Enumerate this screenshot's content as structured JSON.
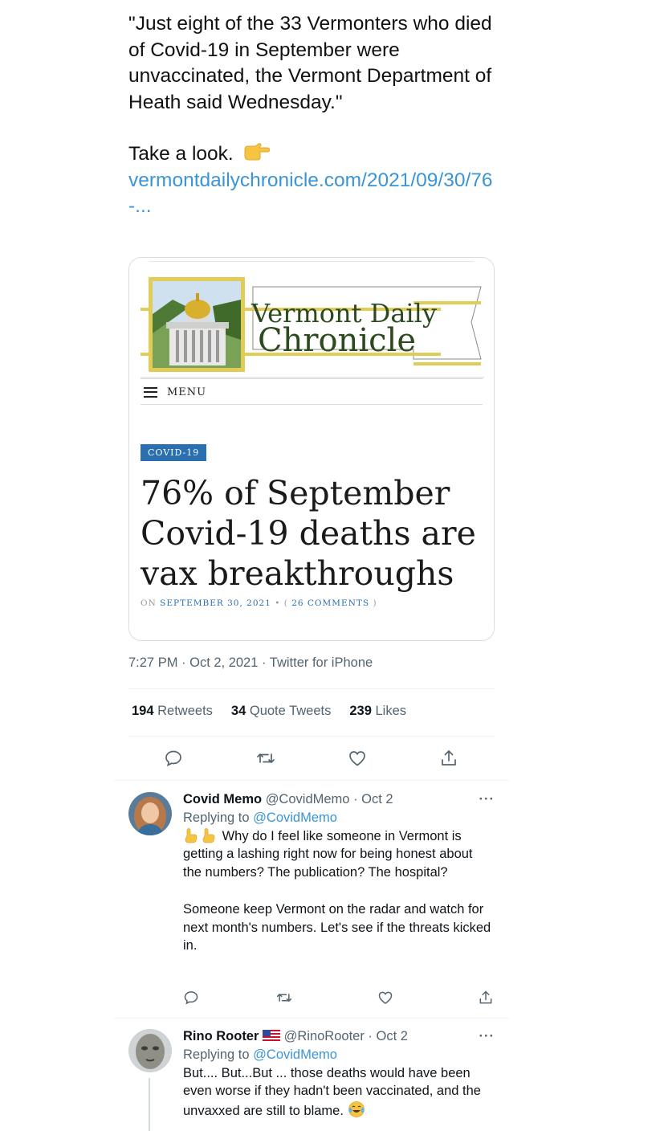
{
  "tweet": {
    "quote": "\"Just eight of the 33 Vermonters who died of  Covid-19 in September were unvaccinated, the Vermont Department of Heath said Wednesday.\"",
    "take_a_look": "Take a look.",
    "link": "vermontdailychronicle.com/2021/09/30/76-...",
    "timestamp": "7:27 PM · Oct 2, 2021 · Twitter for iPhone"
  },
  "card": {
    "site_name_line1": "Vermont Daily",
    "site_name_line2": "Chronicle",
    "menu_label": "MENU",
    "category": "COVID-19",
    "title": "76% of September Covid-19 deaths are vax breakthroughs",
    "meta_on": "ON",
    "meta_date": "SEPTEMBER 30, 2021",
    "meta_sep": " • (",
    "meta_comments": "26 COMMENTS",
    "meta_close": ")"
  },
  "stats": {
    "retweets_count": "194",
    "retweets_label": "Retweets",
    "quotes_count": "34",
    "quotes_label": "Quote Tweets",
    "likes_count": "239",
    "likes_label": "Likes"
  },
  "icons": {
    "reply": "reply-icon",
    "retweet": "retweet-icon",
    "like": "heart-icon",
    "share": "share-icon"
  },
  "replies": [
    {
      "name": "Covid Memo",
      "handle": "@CovidMemo",
      "date": "· Oct 2",
      "replying_prefix": "Replying to",
      "replying_to": "@CovidMemo",
      "text_p1": "Why do I feel like someone in Vermont is getting a lashing right now for being honest about the numbers? The publication? The hospital?",
      "text_p2": "Someone keep Vermont on the radar and watch for next month's numbers. Let's see if the threats kicked in."
    },
    {
      "name": "Rino Rooter",
      "handle": "@RinoRooter",
      "date": "· Oct 2",
      "replying_prefix": "Replying to",
      "replying_to": "@CovidMemo",
      "text": "But.... But...But ... those deaths would have been even worse if they hadn't been vaccinated, and the unvaxxed are still to blame."
    }
  ],
  "more_label": "···",
  "colors": {
    "link": "#3a95d8",
    "muted": "#536471",
    "badge": "#2a6fb0",
    "banner_gold": "#e1cc55",
    "banner_green": "#2d4a1e"
  }
}
